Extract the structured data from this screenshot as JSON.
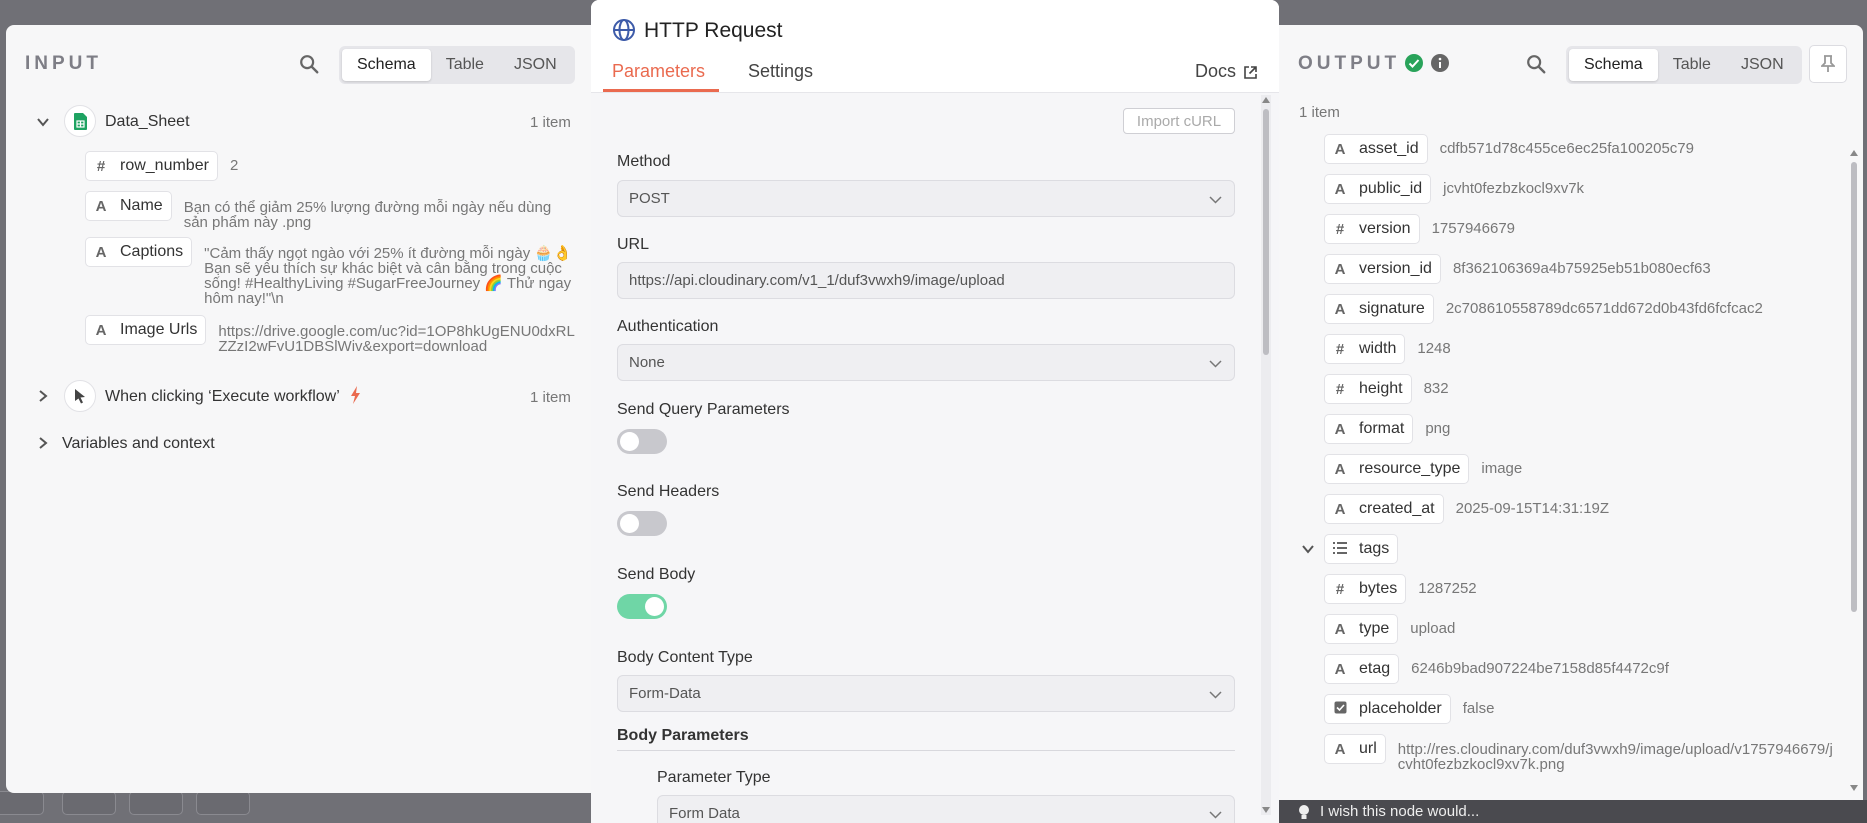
{
  "input": {
    "title": "INPUT",
    "views": [
      "Schema",
      "Table",
      "JSON"
    ],
    "data_sheet": {
      "name": "Data_Sheet",
      "count": "1 item",
      "fields": [
        {
          "type": "#",
          "name": "row_number",
          "value": "2"
        },
        {
          "type": "A",
          "name": "Name",
          "value": "Bạn có thể giảm 25% lượng đường mỗi ngày nếu dùng sản phẩm này .png"
        },
        {
          "type": "A",
          "name": "Captions",
          "value": "\"Cảm thấy ngọt ngào với 25% ít đường mỗi ngày 🧁👌 Bạn sẽ yêu thích sự khác biệt và cân bằng trong cuộc sống! #HealthyLiving #SugarFreeJourney 🌈 Thử ngay hôm nay!\"\\n"
        },
        {
          "type": "A",
          "name": "Image Urls",
          "value": "https://drive.google.com/uc?id=1OP8hkUgENU0dxRLZZzI2wFvU1DBSlWiv&export=download"
        }
      ]
    },
    "trigger": {
      "name": "When clicking ‘Execute workflow’",
      "count": "1 item"
    },
    "variables": "Variables and context"
  },
  "node": {
    "title": "HTTP Request",
    "tabs": [
      "Parameters",
      "Settings"
    ],
    "docs": "Docs",
    "import_curl": "Import cURL",
    "method_label": "Method",
    "method_value": "POST",
    "url_label": "URL",
    "url_value": "https://api.cloudinary.com/v1_1/duf3vwxh9/image/upload",
    "auth_label": "Authentication",
    "auth_value": "None",
    "send_query_label": "Send Query Parameters",
    "send_headers_label": "Send Headers",
    "send_body_label": "Send Body",
    "send_query": false,
    "send_headers": false,
    "send_body": true,
    "body_content_type_label": "Body Content Type",
    "body_content_type_value": "Form-Data",
    "body_params_label": "Body Parameters",
    "param_type_label": "Parameter Type",
    "param_type_value": "Form Data"
  },
  "output": {
    "title": "OUTPUT",
    "views": [
      "Schema",
      "Table",
      "JSON"
    ],
    "count": "1 item",
    "fields": [
      {
        "type": "A",
        "name": "asset_id",
        "value": "cdfb571d78c455ce6ec25fa100205c79"
      },
      {
        "type": "A",
        "name": "public_id",
        "value": "jcvht0fezbzkocl9xv7k"
      },
      {
        "type": "#",
        "name": "version",
        "value": "1757946679"
      },
      {
        "type": "A",
        "name": "version_id",
        "value": "8f362106369a4b75925eb51b080ecf63"
      },
      {
        "type": "A",
        "name": "signature",
        "value": "2c708610558789dc6571dd672d0b43fd6fcfcac2"
      },
      {
        "type": "#",
        "name": "width",
        "value": "1248"
      },
      {
        "type": "#",
        "name": "height",
        "value": "832"
      },
      {
        "type": "A",
        "name": "format",
        "value": "png"
      },
      {
        "type": "A",
        "name": "resource_type",
        "value": "image"
      },
      {
        "type": "A",
        "name": "created_at",
        "value": "2025-09-15T14:31:19Z"
      },
      {
        "type": "list",
        "name": "tags",
        "value": ""
      },
      {
        "type": "#",
        "name": "bytes",
        "value": "1287252"
      },
      {
        "type": "A",
        "name": "type",
        "value": "upload"
      },
      {
        "type": "A",
        "name": "etag",
        "value": "6246b9bad907224be7158d85f4472c9f"
      },
      {
        "type": "check",
        "name": "placeholder",
        "value": "false"
      },
      {
        "type": "A",
        "name": "url",
        "value": "http://res.cloudinary.com/duf3vwxh9/image/upload/v1757946679/jcvht0fezbzkocl9xv7k.png"
      }
    ]
  },
  "feedback": "I wish this node would...",
  "colors": {
    "accent": "#ea6a4f",
    "toggle_on": "#6fd6a6",
    "success": "#29a35a",
    "sheets_green": "#1ea362"
  }
}
